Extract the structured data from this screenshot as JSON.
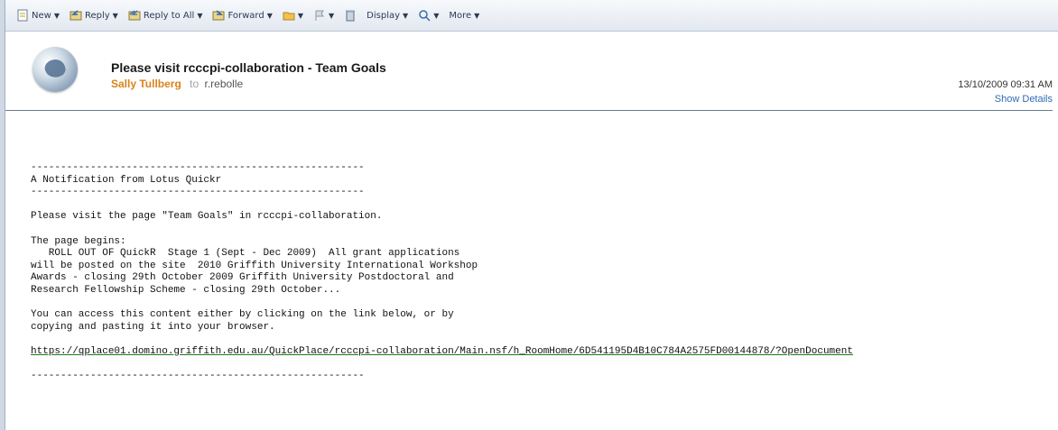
{
  "toolbar": {
    "new_label": "New",
    "reply_label": "Reply",
    "reply_all_label": "Reply to All",
    "forward_label": "Forward",
    "display_label": "Display",
    "more_label": "More"
  },
  "header": {
    "subject": "Please visit rcccpi-collaboration - Team Goals",
    "sender": "Sally Tullberg",
    "to_label": "to",
    "recipient": "r.rebolle",
    "date": "13/10/2009 09:31 AM",
    "show_details": "Show Details"
  },
  "body": {
    "divider_top": "--------------------------------------------------------",
    "notification": "A Notification from Lotus Quickr",
    "divider_mid": "--------------------------------------------------------",
    "visit_line": "Please visit the page \"Team Goals\" in rcccpi-collaboration.",
    "page_begins": "The page begins:",
    "excerpt_1": "   ROLL OUT OF QuickR  Stage 1 (Sept - Dec 2009)  All grant applications",
    "excerpt_2": "will be posted on the site  2010 Griffith University International Workshop",
    "excerpt_3": "Awards - closing 29th October 2009 Griffith University Postdoctoral and",
    "excerpt_4": "Research Fellowship Scheme - closing 29th October...",
    "access_1": "You can access this content either by clicking on the link below, or by",
    "access_2": "copying and pasting it into your browser.",
    "link": "https://qplace01.domino.griffith.edu.au/QuickPlace/rcccpi-collaboration/Main.nsf/h_RoomHome/6D541195D4B10C784A2575FD00144878/?OpenDocument",
    "divider_bottom": "--------------------------------------------------------"
  },
  "colors": {
    "sender": "#d9831c",
    "link_underline": "#1a7a1a",
    "show_details": "#2f6bb3"
  }
}
